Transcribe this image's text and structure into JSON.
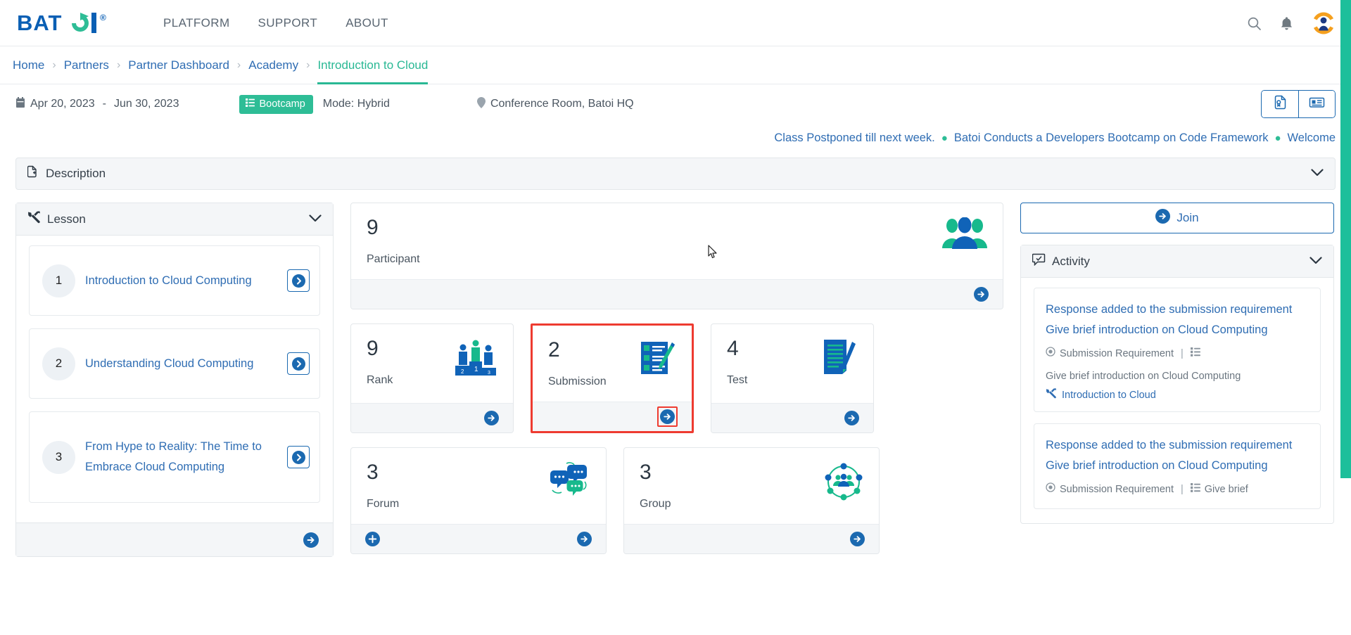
{
  "brand": {
    "name": "BATOI",
    "registered": "®",
    "blue": "#0a5fb4",
    "green": "#2ebd96"
  },
  "nav": {
    "links": [
      {
        "label": "PLATFORM"
      },
      {
        "label": "SUPPORT"
      },
      {
        "label": "ABOUT"
      }
    ],
    "search_icon": "search-icon",
    "bell_icon": "bell-icon",
    "avatar_icon": "user-avatar-icon"
  },
  "breadcrumb": {
    "items": [
      {
        "label": "Home",
        "active": false
      },
      {
        "label": "Partners",
        "active": false
      },
      {
        "label": "Partner Dashboard",
        "active": false
      },
      {
        "label": "Academy",
        "active": false
      },
      {
        "label": "Introduction to Cloud",
        "active": true
      }
    ],
    "separator": "›"
  },
  "meta": {
    "start_date": "Apr 20, 2023",
    "date_dash": "-",
    "end_date": "Jun 30, 2023",
    "badge": "Bootcamp",
    "mode": "Mode: Hybrid",
    "location": "Conference Room, Batoi HQ",
    "buttons": [
      {
        "name": "certificate-button",
        "icon": "certificate-icon"
      },
      {
        "name": "news-card-button",
        "icon": "news-card-icon"
      }
    ]
  },
  "ticker": {
    "items": [
      "Class Postponed till next week.",
      "Batoi Conducts a Developers Bootcamp on Code Framework",
      "Welcome"
    ],
    "dot": "●"
  },
  "description": {
    "title": "Description",
    "icon": "document-add-icon",
    "chevron": "⌄"
  },
  "lesson": {
    "title": "Lesson",
    "icon": "tools-icon",
    "chevron": "⌄",
    "items": [
      {
        "num": "1",
        "title": "Introduction to Cloud Computing"
      },
      {
        "num": "2",
        "title": "Understanding Cloud Computing"
      },
      {
        "num": "3",
        "title": "From Hype to Reality: The Time to Embrace Cloud Computing"
      }
    ],
    "footer_arrow": "arrow-right-circle-icon"
  },
  "cards": [
    {
      "num": "9",
      "label": "Participant",
      "icon": "people-group-icon",
      "size": "wide",
      "highlight": false,
      "footer_left": null,
      "footer_right": "arrow-right-circle-icon"
    },
    {
      "num": "9",
      "label": "Rank",
      "icon": "podium-icon",
      "size": "third",
      "highlight": false,
      "footer_left": null,
      "footer_right": "arrow-right-circle-icon"
    },
    {
      "num": "2",
      "label": "Submission",
      "icon": "submission-checklist-icon",
      "size": "third",
      "highlight": true,
      "footer_left": null,
      "footer_right": "arrow-right-circle-icon"
    },
    {
      "num": "4",
      "label": "Test",
      "icon": "test-paper-icon",
      "size": "third",
      "highlight": false,
      "footer_left": null,
      "footer_right": "arrow-right-circle-icon"
    },
    {
      "num": "3",
      "label": "Forum",
      "icon": "chat-bubbles-icon",
      "size": "half",
      "highlight": false,
      "footer_left": "plus-circle-icon",
      "footer_right": "arrow-right-circle-icon"
    },
    {
      "num": "3",
      "label": "Group",
      "icon": "group-network-icon",
      "size": "half",
      "highlight": false,
      "footer_left": null,
      "footer_right": "arrow-right-circle-icon"
    }
  ],
  "join": {
    "label": "Join",
    "icon": "arrow-right-circle-icon"
  },
  "activity": {
    "title": "Activity",
    "icon": "activity-comment-icon",
    "chevron": "⌄",
    "items": [
      {
        "title": "Response added to the submission requirement Give brief introduction on Cloud Computing",
        "meta_type": "Submission Requirement",
        "meta_sep": "|",
        "meta_name": "Give brief introduction on Cloud Computing",
        "course": "Introduction to Cloud"
      },
      {
        "title": "Response added to the submission requirement Give brief introduction on Cloud Computing",
        "meta_type": "Submission Requirement",
        "meta_sep": "|",
        "meta_name": "Give brief",
        "course": ""
      }
    ]
  },
  "colors": {
    "accent_blue": "#1b69b0",
    "link_blue": "#2f6db3",
    "green": "#2ebd96",
    "highlight_red": "#ee3b30",
    "panel_grey": "#f4f6f8"
  }
}
